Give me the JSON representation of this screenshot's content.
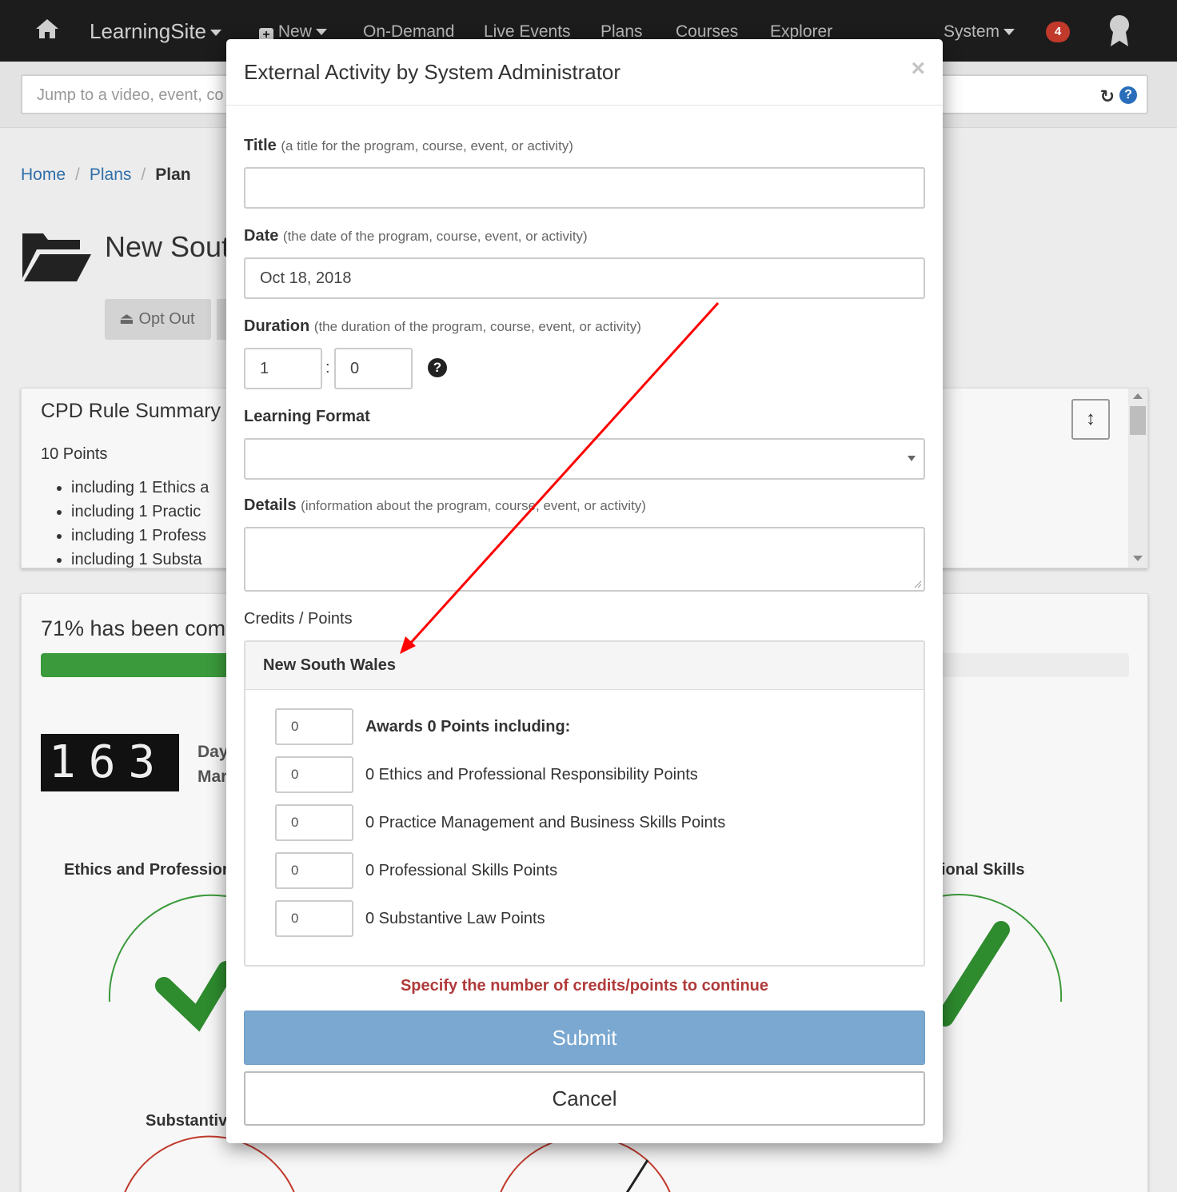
{
  "nav": {
    "brand": "LearningSite",
    "new_label": "New",
    "links": [
      "On-Demand",
      "Live Events",
      "Plans",
      "Courses",
      "Explorer"
    ],
    "system_label": "System",
    "notification_count": "4",
    "icons": [
      "home-icon",
      "plus-square-icon",
      "award-ribbon-icon"
    ]
  },
  "search": {
    "placeholder": "Jump to a video, event, co"
  },
  "breadcrumb": {
    "home": "Home",
    "plans": "Plans",
    "current": "Plan"
  },
  "plan": {
    "title": "New Sout",
    "opt_out_label": "Opt Out"
  },
  "rule_summary": {
    "heading": "CPD Rule Summary",
    "points": "10 Points",
    "items": [
      "including 1 Ethics a",
      "including 1 Practic",
      "including 1 Profess",
      "including 1 Substa"
    ]
  },
  "progress": {
    "completed_text": "71% has been comp",
    "percent": 71,
    "counter": "163",
    "day_label_1": "Day",
    "day_label_2": "Mar",
    "gauge_labels": [
      "Ethics and Profession",
      "ional Skills",
      "Substantiv"
    ],
    "colors": {
      "bar": "#3b9a3b",
      "check": "#2e8b2e",
      "fail_arc": "#c0392b"
    }
  },
  "modal": {
    "title": "External Activity by System Administrator",
    "close_symbol": "×",
    "title_label": "Title",
    "title_hint": "(a title for the program, course, event, or activity)",
    "title_value": "",
    "date_label": "Date",
    "date_hint": "(the date of the program, course, event, or activity)",
    "date_value": "Oct 18, 2018",
    "duration_label": "Duration",
    "duration_hint": "(the duration of the program, course, event, or activity)",
    "duration_hours": "1",
    "duration_separator": ":",
    "duration_minutes": "0",
    "format_label": "Learning Format",
    "format_value": "",
    "details_label": "Details",
    "details_hint": "(information about the program, course, event, or activity)",
    "credits_label": "Credits / Points",
    "jurisdiction": "New South Wales",
    "point_rows": [
      {
        "value": "0",
        "label": "Awards 0 Points including:"
      },
      {
        "value": "0",
        "label": "0 Ethics and Professional Responsibility Points"
      },
      {
        "value": "0",
        "label": "0 Practice Management and Business Skills Points"
      },
      {
        "value": "0",
        "label": "0 Professional Skills Points"
      },
      {
        "value": "0",
        "label": "0 Substantive Law Points"
      }
    ],
    "warning": "Specify the number of credits/points to continue",
    "submit_label": "Submit",
    "cancel_label": "Cancel",
    "colors": {
      "warning": "#b03a3a",
      "submit": "#7aa8d0",
      "annotation_arrow": "#ff0000"
    }
  }
}
